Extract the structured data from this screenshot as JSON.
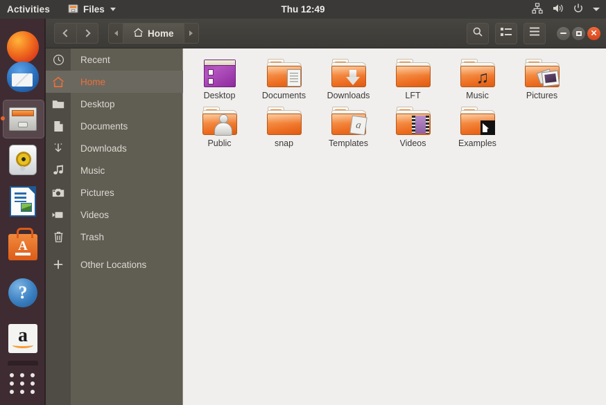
{
  "topbar": {
    "activities": "Activities",
    "app_name": "Files",
    "app_icon": "files-cabinet-icon",
    "clock": "Thu 12:49",
    "indicators": [
      "network-icon",
      "volume-icon",
      "power-icon",
      "dropdown-caret-icon"
    ]
  },
  "launcher": {
    "items": [
      {
        "name": "firefox",
        "label": "Firefox"
      },
      {
        "name": "thunderbird",
        "label": "Thunderbird"
      },
      {
        "name": "files",
        "label": "Files",
        "active": true
      },
      {
        "name": "rhythmbox",
        "label": "Rhythmbox"
      },
      {
        "name": "libreoffice",
        "label": "LibreOffice Writer"
      },
      {
        "name": "ubuntu-software",
        "label": "Ubuntu Software"
      },
      {
        "name": "help",
        "label": "Help"
      },
      {
        "name": "amazon",
        "label": "Amazon"
      }
    ],
    "show_apps_label": "Show Applications"
  },
  "headerbar": {
    "back_label": "Back",
    "forward_label": "Forward",
    "path_label": "Home",
    "path_icon": "home-icon",
    "search_label": "Search",
    "view_toggle_label": "View options",
    "menu_label": "Menu",
    "window_minimize": "Minimize",
    "window_maximize": "Maximize",
    "window_close": "Close"
  },
  "sidebar": {
    "items": [
      {
        "label": "Recent",
        "icon": "clock-icon",
        "selected": false
      },
      {
        "label": "Home",
        "icon": "home-icon",
        "selected": true
      },
      {
        "label": "Desktop",
        "icon": "folder-icon",
        "selected": false
      },
      {
        "label": "Documents",
        "icon": "document-icon",
        "selected": false
      },
      {
        "label": "Downloads",
        "icon": "download-icon",
        "selected": false
      },
      {
        "label": "Music",
        "icon": "music-note-icon",
        "selected": false
      },
      {
        "label": "Pictures",
        "icon": "camera-icon",
        "selected": false
      },
      {
        "label": "Videos",
        "icon": "video-camera-icon",
        "selected": false
      },
      {
        "label": "Trash",
        "icon": "trash-icon",
        "selected": false
      },
      {
        "label": "Other Locations",
        "icon": "plus-icon",
        "selected": false
      }
    ]
  },
  "content": {
    "files": [
      {
        "name": "Desktop",
        "icon": "desktop-window-icon"
      },
      {
        "name": "Documents",
        "icon": "folder-documents-icon"
      },
      {
        "name": "Downloads",
        "icon": "folder-downloads-icon"
      },
      {
        "name": "LFT",
        "icon": "folder-icon"
      },
      {
        "name": "Music",
        "icon": "folder-music-icon"
      },
      {
        "name": "Pictures",
        "icon": "folder-pictures-icon"
      },
      {
        "name": "Public",
        "icon": "folder-public-icon"
      },
      {
        "name": "snap",
        "icon": "folder-icon"
      },
      {
        "name": "Templates",
        "icon": "folder-templates-icon"
      },
      {
        "name": "Videos",
        "icon": "folder-videos-icon"
      },
      {
        "name": "Examples",
        "icon": "folder-symlink-icon"
      }
    ]
  },
  "colors": {
    "accent": "#e8713a",
    "sidebar_bg": "#605d53",
    "content_bg": "#f0efee",
    "topbar_bg": "#3a3937",
    "launcher_bg": "#3f2c32",
    "close_button": "#d8441a"
  }
}
